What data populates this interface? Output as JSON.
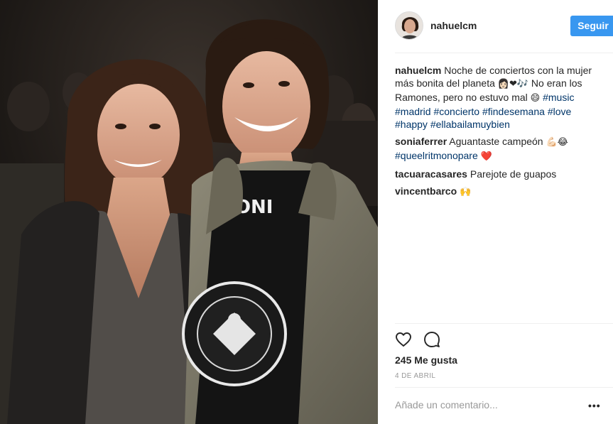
{
  "post": {
    "username": "nahuelcm",
    "follow_label": "Seguir",
    "photo_alt": "photo-of-couple-at-concert"
  },
  "comments": [
    {
      "author": "nahuelcm",
      "parts": [
        {
          "type": "text",
          "value": "Noche de conciertos con la mujer más bonita del planeta "
        },
        {
          "type": "emoji",
          "value": "👩🏻❤🎶"
        },
        {
          "type": "text",
          "value": " No eran los Ramones, pero no estuvo mal "
        },
        {
          "type": "emoji",
          "value": "😄"
        },
        {
          "type": "text",
          "value": " "
        },
        {
          "type": "tag",
          "value": "#music"
        },
        {
          "type": "text",
          "value": " "
        },
        {
          "type": "tag",
          "value": "#madrid"
        },
        {
          "type": "text",
          "value": " "
        },
        {
          "type": "tag",
          "value": "#concierto"
        },
        {
          "type": "text",
          "value": " "
        },
        {
          "type": "tag",
          "value": "#findesemana"
        },
        {
          "type": "text",
          "value": " "
        },
        {
          "type": "tag",
          "value": "#love"
        },
        {
          "type": "text",
          "value": " "
        },
        {
          "type": "tag",
          "value": "#happy"
        },
        {
          "type": "text",
          "value": " "
        },
        {
          "type": "tag",
          "value": "#ellabailamuybien"
        }
      ]
    },
    {
      "author": "soniaferrer",
      "parts": [
        {
          "type": "text",
          "value": "Aguantaste campeón "
        },
        {
          "type": "emoji",
          "value": "💪🏻😂"
        },
        {
          "type": "text",
          "value": " "
        },
        {
          "type": "tag",
          "value": "#queelritmonopare"
        },
        {
          "type": "text",
          "value": " "
        },
        {
          "type": "emoji",
          "value": "❤️"
        }
      ]
    },
    {
      "author": "tacuaracasares",
      "parts": [
        {
          "type": "text",
          "value": "Parejote de guapos"
        }
      ]
    },
    {
      "author": "vincentbarco",
      "parts": [
        {
          "type": "emoji",
          "value": "🙌"
        }
      ]
    }
  ],
  "actions": {
    "like_icon": "heart-icon",
    "comment_icon": "comment-bubble-icon"
  },
  "likes_text": "245 Me gusta",
  "date_text": "4 DE ABRIL",
  "comment_placeholder": "Añade un comentario...",
  "more_label": "•••",
  "colors": {
    "follow_button": "#3897f0",
    "hashtag": "#003569",
    "muted": "#999999",
    "text": "#262626"
  }
}
